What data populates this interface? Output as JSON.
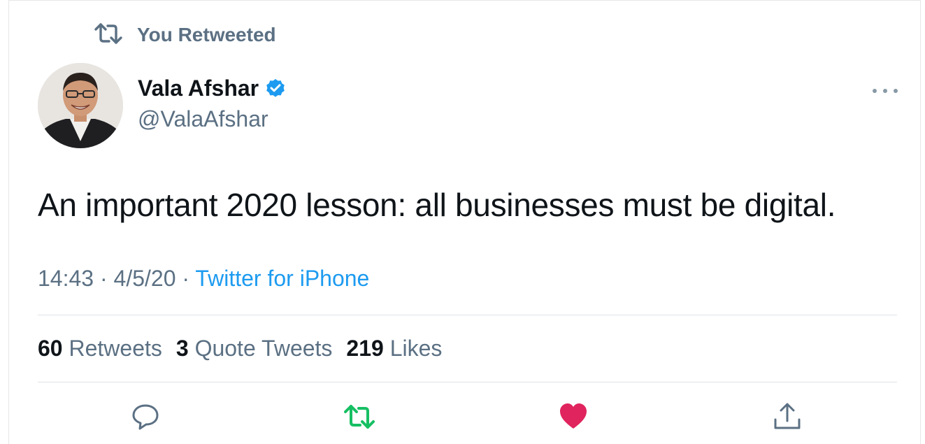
{
  "retweet_context": {
    "label": "You Retweeted",
    "icon": "retweet-icon"
  },
  "author": {
    "display_name": "Vala Afshar",
    "handle": "@ValaAfshar",
    "verified": true,
    "verified_icon": "verified-badge-icon"
  },
  "tweet": {
    "text": "An important 2020 lesson: all businesses must be digital.",
    "time": "14:43",
    "separator": "·",
    "date": "4/5/20",
    "source": "Twitter for iPhone"
  },
  "stats": {
    "retweets_count": "60",
    "retweets_label": "Retweets",
    "quotes_count": "3",
    "quotes_label": "Quote Tweets",
    "likes_count": "219",
    "likes_label": "Likes"
  },
  "actions": {
    "reply_icon": "reply-icon",
    "retweet_icon": "retweet-icon",
    "like_icon": "heart-icon",
    "share_icon": "share-icon"
  },
  "colors": {
    "secondary_text": "#5b7083",
    "link": "#1d9bf0",
    "verified": "#1d9bf0",
    "retweet_active": "#17bf63",
    "like_active": "#e0245e"
  }
}
